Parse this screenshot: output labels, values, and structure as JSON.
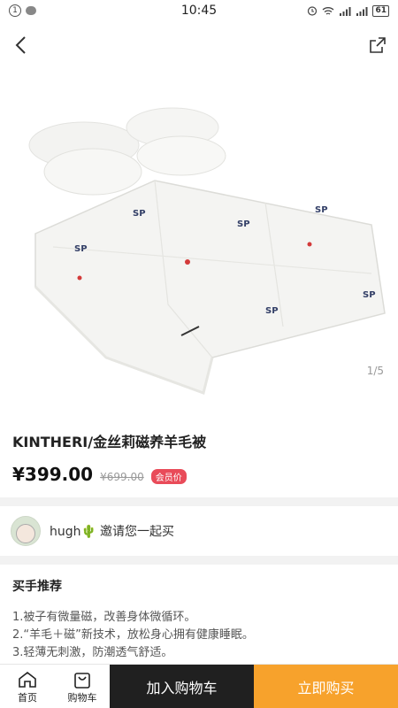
{
  "status_bar": {
    "notification_count": "1",
    "time": "10:45",
    "battery": "61"
  },
  "hero": {
    "pager": "1/5"
  },
  "product": {
    "title": "KINTHERI/金丝莉磁养羊毛被",
    "price": "¥399.00",
    "original_price": "¥699.00",
    "member_tag": "会员价"
  },
  "invite": {
    "username": "hugh",
    "text": "邀请您一起买"
  },
  "recommend": {
    "title": "买手推荐",
    "items": [
      "1.被子有微量磁，改善身体微循环。",
      "2.“羊毛＋磁”新技术，放松身心拥有健康睡眠。",
      "3.轻薄无刺激，防潮透气舒适。"
    ]
  },
  "bottom_bar": {
    "home": "首页",
    "cart": "购物车",
    "add_to_cart": "加入购物车",
    "buy_now": "立即购买"
  },
  "colors": {
    "buy_button": "#f7a22c",
    "cart_button": "#202020",
    "member_tag": "#e94b59"
  }
}
